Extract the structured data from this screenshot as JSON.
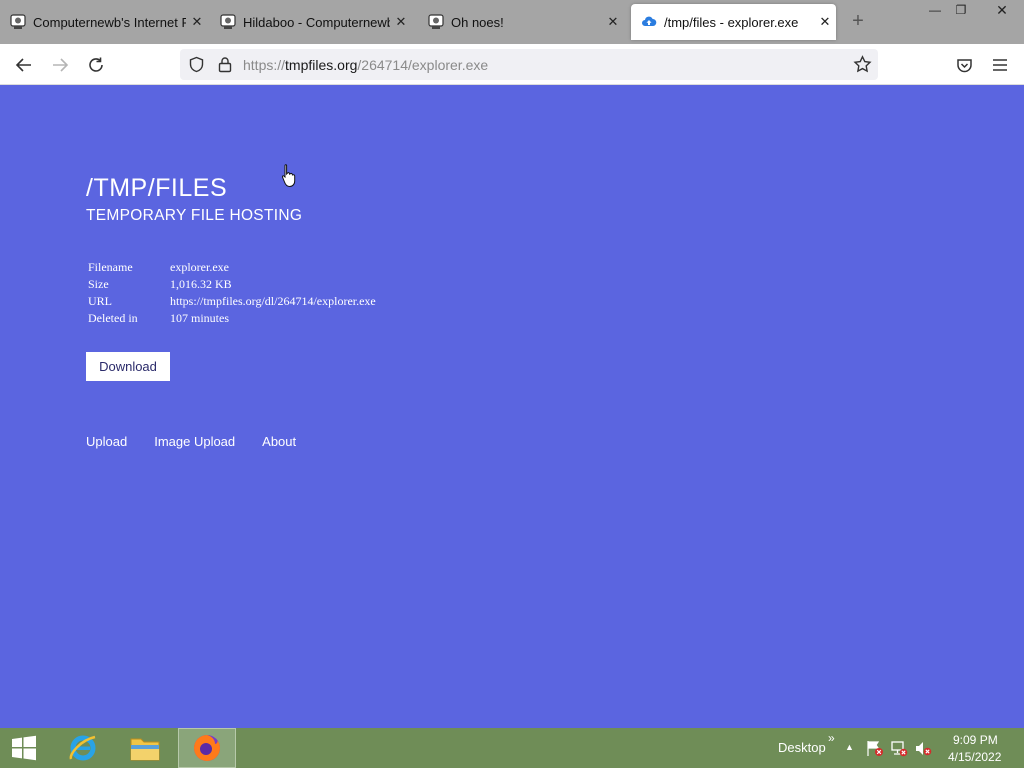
{
  "browser": {
    "tabs": [
      {
        "title": "Computernewb's Internet Pu",
        "active": false,
        "icon": "vm-icon"
      },
      {
        "title": "Hildaboo - Computernewb V",
        "active": false,
        "icon": "vm-icon"
      },
      {
        "title": "Oh noes!",
        "active": false,
        "icon": "vm-icon"
      },
      {
        "title": "/tmp/files - explorer.exe",
        "active": true,
        "icon": "cloud-upload-icon"
      }
    ],
    "close_glyph": "✕",
    "new_tab_glyph": "+",
    "window_controls": {
      "minimize": "—",
      "restore": "❐",
      "close": "✕"
    },
    "url_prefix": "https://",
    "url_host": "tmpfiles.org",
    "url_path": "/264714/explorer.exe"
  },
  "site": {
    "title": "/TMP/FILES",
    "subtitle": "TEMPORARY FILE HOSTING",
    "info": [
      {
        "key": "Filename",
        "value": "explorer.exe"
      },
      {
        "key": "Size",
        "value": "1,016.32 KB"
      },
      {
        "key": "URL",
        "value": "https://tmpfiles.org/dl/264714/explorer.exe"
      },
      {
        "key": "Deleted in",
        "value": "107 minutes"
      }
    ],
    "download_label": "Download",
    "footer_links": [
      "Upload",
      "Image Upload",
      "About"
    ]
  },
  "taskbar": {
    "desktop_label": "Desktop",
    "chevron": "»",
    "tray_arrow": "▲",
    "time": "9:09 PM",
    "date": "4/15/2022"
  },
  "colors": {
    "page_bg": "#5b65e0",
    "taskbar_bg": "#6f8d57",
    "tabstrip_bg": "#a5a5a5"
  }
}
